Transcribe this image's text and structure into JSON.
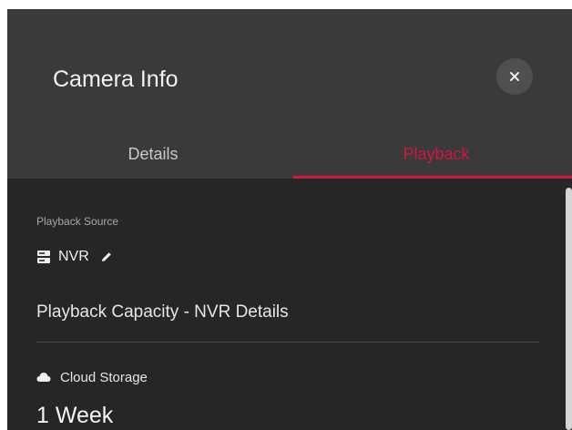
{
  "dialog": {
    "title": "Camera Info",
    "close_icon": "close-icon"
  },
  "tabs": [
    {
      "label": "Details",
      "active": false
    },
    {
      "label": "Playback",
      "active": true
    }
  ],
  "colors": {
    "accent": "#d2163f",
    "header_bg": "#3a3a3a",
    "content_bg": "#262626"
  },
  "playback_source": {
    "label": "Playback Source",
    "icon": "server-icon",
    "value": "NVR",
    "edit_icon": "pencil-icon"
  },
  "capacity": {
    "heading": "Playback Capacity - NVR Details"
  },
  "cloud_storage": {
    "icon": "cloud-icon",
    "label": "Cloud Storage",
    "value": "1 Week"
  }
}
